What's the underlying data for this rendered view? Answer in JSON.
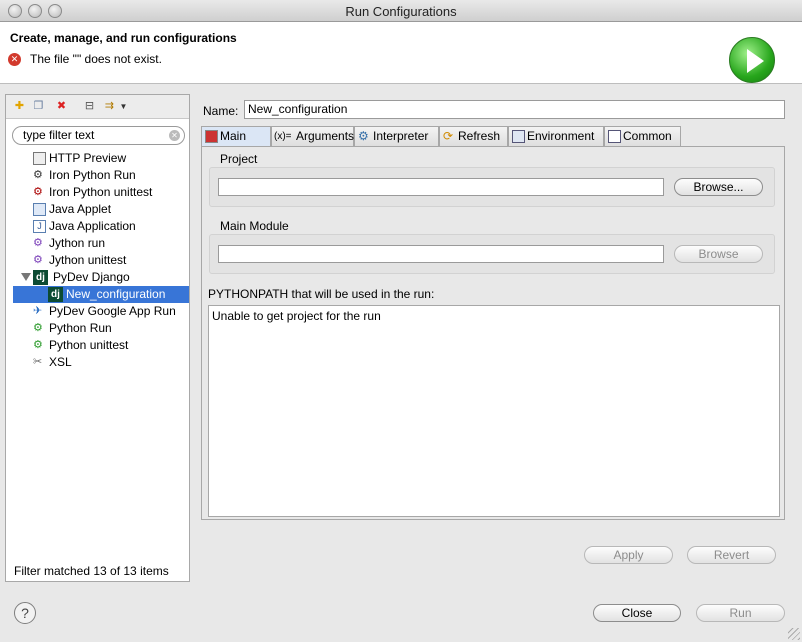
{
  "window": {
    "title": "Run Configurations"
  },
  "header": {
    "title": "Create, manage, and run configurations",
    "error_message": "The file \"\" does not exist."
  },
  "left_panel": {
    "filter_placeholder": "type filter text",
    "items": [
      {
        "label": "HTTP Preview",
        "icon": "http-preview-icon",
        "level": 0,
        "selected": false
      },
      {
        "label": "Iron Python Run",
        "icon": "iron-python-icon",
        "level": 0,
        "selected": false
      },
      {
        "label": "Iron Python unittest",
        "icon": "iron-python-unittest-icon",
        "level": 0,
        "selected": false
      },
      {
        "label": "Java Applet",
        "icon": "java-applet-icon",
        "level": 0,
        "selected": false
      },
      {
        "label": "Java Application",
        "icon": "java-application-icon",
        "level": 0,
        "selected": false
      },
      {
        "label": "Jython run",
        "icon": "jython-icon",
        "level": 0,
        "selected": false
      },
      {
        "label": "Jython unittest",
        "icon": "jython-unittest-icon",
        "level": 0,
        "selected": false
      },
      {
        "label": "PyDev Django",
        "icon": "django-icon",
        "level": 0,
        "selected": false,
        "expanded": true
      },
      {
        "label": "New_configuration",
        "icon": "django-icon",
        "level": 1,
        "selected": true
      },
      {
        "label": "PyDev Google App Run",
        "icon": "google-app-icon",
        "level": 0,
        "selected": false
      },
      {
        "label": "Python Run",
        "icon": "python-icon",
        "level": 0,
        "selected": false
      },
      {
        "label": "Python unittest",
        "icon": "python-unittest-icon",
        "level": 0,
        "selected": false
      },
      {
        "label": "XSL",
        "icon": "xsl-icon",
        "level": 0,
        "selected": false
      }
    ],
    "status": "Filter matched 13 of 13 items"
  },
  "right_panel": {
    "name_label": "Name:",
    "name_value": "New_configuration",
    "tabs": [
      {
        "label": "Main",
        "icon": "main-tab-icon",
        "active": true
      },
      {
        "label": "Arguments",
        "icon": "arguments-tab-icon",
        "active": false
      },
      {
        "label": "Interpreter",
        "icon": "interpreter-tab-icon",
        "active": false
      },
      {
        "label": "Refresh",
        "icon": "refresh-tab-icon",
        "active": false
      },
      {
        "label": "Environment",
        "icon": "environment-tab-icon",
        "active": false
      },
      {
        "label": "Common",
        "icon": "common-tab-icon",
        "active": false
      }
    ],
    "project": {
      "label": "Project",
      "value": "",
      "browse_label": "Browse..."
    },
    "main_module": {
      "label": "Main Module",
      "value": "",
      "browse_label": "Browse"
    },
    "pythonpath": {
      "label": "PYTHONPATH that will be used in the run:",
      "value": "Unable to get project for the run"
    },
    "apply_label": "Apply",
    "revert_label": "Revert"
  },
  "footer": {
    "help_icon": "?",
    "close_label": "Close",
    "run_label": "Run"
  },
  "colors": {
    "selection": "#3875d7",
    "error": "#d23a2d",
    "run_green": "#27a61c"
  }
}
